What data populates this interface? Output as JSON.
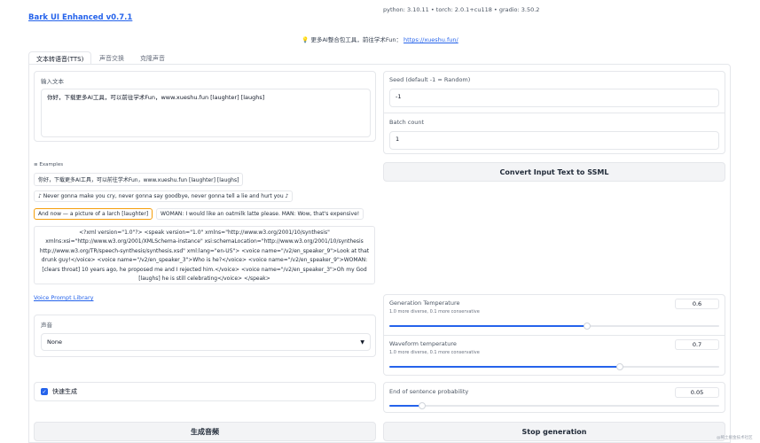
{
  "app": {
    "title": "Bark UI Enhanced v0.7.1"
  },
  "versions": "python: 3.10.11  •  torch: 2.0.1+cu118  •  gradio: 3.50.2",
  "banner": {
    "icon": "lightbulb-icon",
    "text": "更多AI整合包工具，前往学术Fun：",
    "link": "https://xueshu.fun/"
  },
  "tabs": [
    {
      "label": "文本转语音(TTS)"
    },
    {
      "label": "声音交换"
    },
    {
      "label": "克隆声音"
    }
  ],
  "tts": {
    "input_label": "输入文本",
    "input_value": "你好，下载更多AI工具，可以前往学术Fun，www.xueshu.fun [laughter] [laughs]",
    "examples_label": "Examples",
    "examples": [
      "你好，下载更多AI工具，可以前往学术Fun，www.xueshu.fun [laughter] [laughs]",
      "♪ Never gonna make you cry, never gonna say goodbye, never gonna tell a lie and hurt you ♪",
      "And now — a picture of a larch [laughter]",
      "WOMAN: I would like an oatmilk latte please. MAN: Wow, that's expensive!",
      "<?xml version=\"1.0\"?> <speak version=\"1.0\" xmlns=\"http://www.w3.org/2001/10/synthesis\" xmlns:xsi=\"http://www.w3.org/2001/XMLSchema-instance\" xsi:schemaLocation=\"http://www.w3.org/2001/10/synthesis http://www.w3.org/TR/speech-synthesis/synthesis.xsd\" xml:lang=\"en-US\"> <voice name=\"/v2/en_speaker_9\">Look at that drunk guy!</voice> <voice name=\"/v2/en_speaker_3\">Who is he?</voice> <voice name=\"/v2/en_speaker_9\">WOMAN: [clears throat] 10 years ago, he proposed me and I rejected him.</voice> <voice name=\"/v2/en_speaker_3\">Oh my God [laughs] he is still celebrating</voice> </speak>"
    ],
    "voice_library_link": "Voice Prompt Library",
    "voice_label": "声音",
    "voice_value": "None",
    "quick_gen_label": "快速生成",
    "quick_gen_checked": true,
    "generate_button": "生成音频",
    "seed_label": "Seed (default -1 = Random)",
    "seed_value": "-1",
    "batch_label": "Batch count",
    "batch_value": "1",
    "convert_button": "Convert Input Text to SSML",
    "gen_temp": {
      "label": "Generation Temperature",
      "hint": "1.0 more diverse, 0.1 more conservative",
      "value": "0.6",
      "fraction": 0.6
    },
    "wave_temp": {
      "label": "Waveform temperature",
      "hint": "1.0 more diverse, 0.1 more conservative",
      "value": "0.7",
      "fraction": 0.7
    },
    "eos": {
      "label": "End of sentence probability",
      "value": "0.05",
      "fraction": 0.1
    },
    "stop_button": "Stop generation"
  },
  "watermark": "@稀土掘金技术社区",
  "colors": {
    "accent": "#2563eb",
    "selected_example_border": "#f59e0b"
  }
}
